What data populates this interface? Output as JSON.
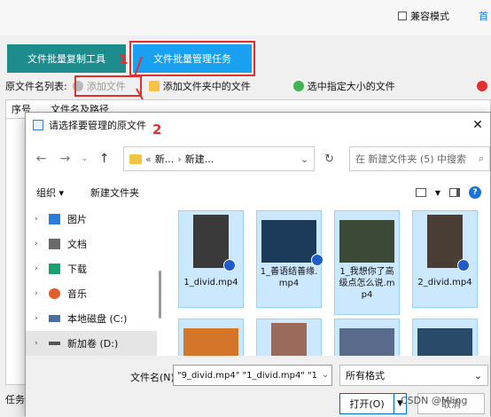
{
  "app": {
    "compat_label": "兼容模式",
    "top_right_fragment": "首",
    "tabs": {
      "copy": "文件批量复制工具",
      "manage": "文件批量管理任务"
    },
    "annotations": {
      "step1": "1",
      "step2": "2"
    },
    "toolbar": {
      "label": "原文件名列表:",
      "add_file": "添加文件",
      "add_folder": "添加文件夹中的文件",
      "select_size": "选中指定大小的文件"
    },
    "list": {
      "col_index": "序号",
      "col_name": "文件名及路径"
    },
    "task_label": "任务"
  },
  "dialog": {
    "title": "请选择要管理的原文件",
    "path": {
      "seg1": "新...",
      "seg2": "新建..."
    },
    "search_placeholder": "在 新建文件夹 (5) 中搜索",
    "organize": "组织 ▾",
    "new_folder": "新建文件夹",
    "nav_items": [
      {
        "label": "图片",
        "icon": "pictures-icon",
        "color": "#2d7bd6"
      },
      {
        "label": "文档",
        "icon": "documents-icon",
        "color": "#6a6a6a"
      },
      {
        "label": "下载",
        "icon": "downloads-icon",
        "color": "#19a070"
      },
      {
        "label": "音乐",
        "icon": "music-icon",
        "color": "#e0602a"
      },
      {
        "label": "本地磁盘 (C:)",
        "icon": "drive-icon",
        "color": "#4a6fa5"
      },
      {
        "label": "新加卷 (D:)",
        "icon": "drive-icon",
        "color": "#555555"
      }
    ],
    "files": [
      {
        "name": "1_divid.mp4"
      },
      {
        "name": "1_善语结善缘.mp4"
      },
      {
        "name": "1_我想你了高级点怎么说.mp4"
      },
      {
        "name": "2_divid.mp4"
      },
      {
        "name": ""
      },
      {
        "name": ""
      },
      {
        "name": ""
      },
      {
        "name": ""
      }
    ],
    "filename_label": "文件名(N):",
    "filename_value": "\"9_divid.mp4\" \"1_divid.mp4\" \"1",
    "filter": "所有格式",
    "open": "打开(O)",
    "cancel": "取消"
  },
  "watermark": "CSDN @Mling"
}
